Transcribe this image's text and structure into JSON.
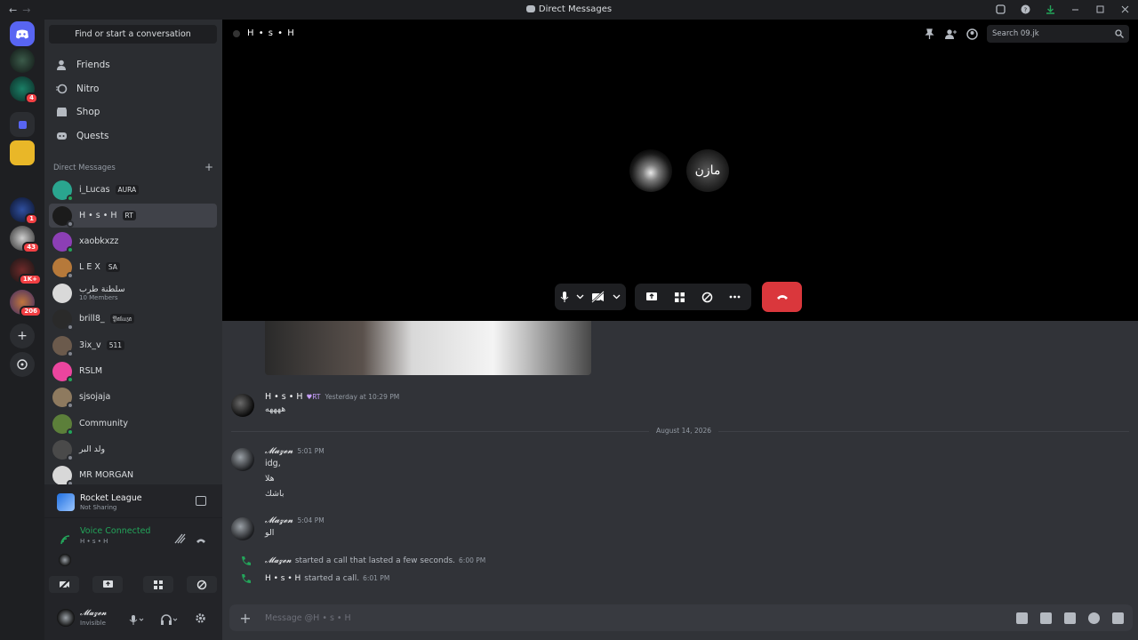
{
  "window": {
    "title": "Direct Messages"
  },
  "sidebar": {
    "find_label": "Find or start a conversation",
    "nav": [
      {
        "label": "Friends",
        "icon": "friends-icon"
      },
      {
        "label": "Nitro",
        "icon": "nitro-icon"
      },
      {
        "label": "Shop",
        "icon": "shop-icon"
      },
      {
        "label": "Quests",
        "icon": "quests-icon"
      }
    ],
    "dm_header": "Direct Messages",
    "dms": [
      {
        "name": "i_Lucas",
        "tag": "AURA",
        "color": "#2aa58f"
      },
      {
        "name": "H • s • H",
        "tag": "RT",
        "color": "#1b1b1b"
      },
      {
        "name": "xaobkxzz",
        "tag": "",
        "color": "#8c3fb5"
      },
      {
        "name": "L E X",
        "tag": "SA",
        "color": "#b6793a"
      },
      {
        "name": "سلطنة طرب",
        "sub": "10 Members",
        "tag": "",
        "color": "#d9d9d9"
      },
      {
        "name": "brill8_",
        "tag": "𝔜𝔞𝔨𝔲𝔷𝔞",
        "color": "#2a2a2a"
      },
      {
        "name": "3ix_v",
        "tag": "511",
        "color": "#6b5a4c"
      },
      {
        "name": "RSLM",
        "tag": "",
        "color": "#eb459e"
      },
      {
        "name": "sjsojaja",
        "tag": "",
        "color": "#8e7a5f"
      },
      {
        "name": "Community",
        "tag": "",
        "color": "#5c7f3a"
      },
      {
        "name": "ولد البر",
        "tag": "",
        "color": "#4a4a4a"
      },
      {
        "name": "MR MORGAN",
        "tag": "",
        "color": "#d8d8d8"
      }
    ]
  },
  "rail": {
    "badges": [
      "4",
      "1",
      "43",
      "1K+",
      "206"
    ]
  },
  "panel": {
    "activity_title": "Rocket League",
    "activity_sub": "Not Sharing",
    "voice_title": "Voice Connected",
    "voice_sub": "H • s • H",
    "user_name": "𝓜𝓪𝔃𝓮𝓷",
    "user_status": "Invisible"
  },
  "call": {
    "channel": "H • s • H",
    "search_placeholder": "Search 09.jk",
    "avatar2_text": "مازن"
  },
  "messages": [
    {
      "author": "H • s • H",
      "tag": "RT",
      "time": "Yesterday at 10:29 PM",
      "lines": [
        "ههههه"
      ]
    },
    {
      "author": "𝓜𝓪𝔃𝓮𝓷",
      "tag": "",
      "time": "5:01 PM",
      "lines": [
        "idg,",
        "هلا",
        "باشك"
      ]
    },
    {
      "author": "𝓜𝓪𝔃𝓮𝓷",
      "tag": "",
      "time": "5:04 PM",
      "lines": [
        "الو"
      ]
    }
  ],
  "divider": "August 14, 2026",
  "system": [
    {
      "actor": "𝓜𝓪𝔃𝓮𝓷",
      "text": "started a call that lasted a few seconds.",
      "time": "6:00 PM"
    },
    {
      "actor": "H • s • H",
      "text": "started a call.",
      "time": "6:01 PM"
    }
  ],
  "composer": {
    "placeholder": "Message @H • s • H"
  }
}
